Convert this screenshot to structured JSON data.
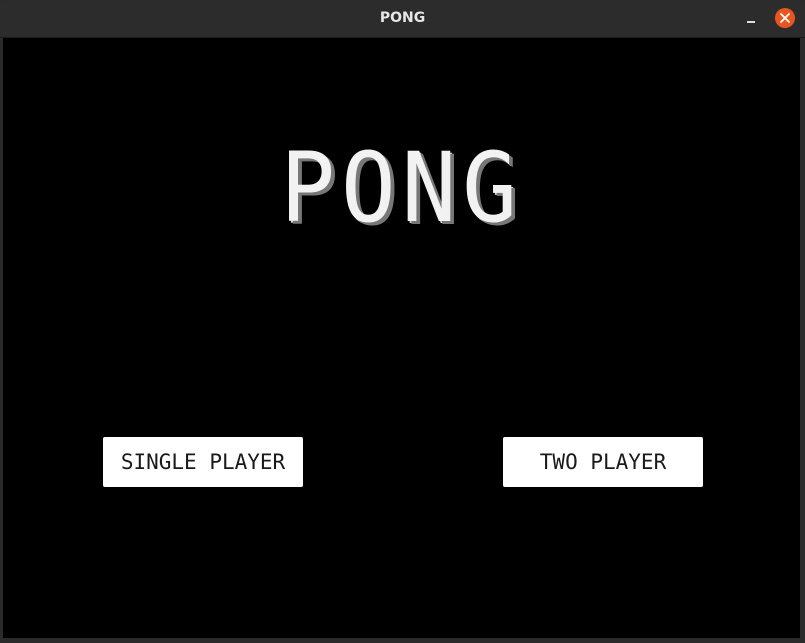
{
  "window": {
    "title": "PONG"
  },
  "game": {
    "logo": "PONG",
    "menu": {
      "single_player_label": "SINGLE PLAYER",
      "two_player_label": "TWO PLAYER"
    }
  },
  "colors": {
    "background": "#000000",
    "text": "#ffffff",
    "close_button": "#e9541f"
  }
}
